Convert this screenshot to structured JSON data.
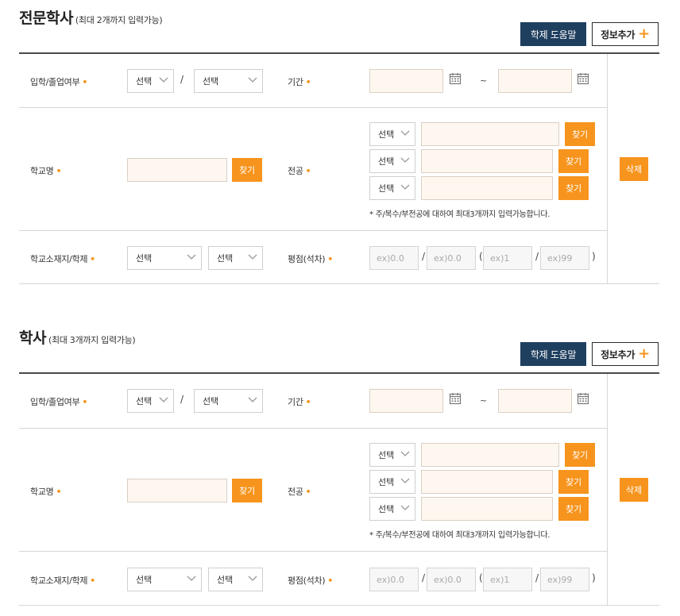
{
  "sections": [
    {
      "title": "전문학사",
      "subtitle": "(최대 2개까지 입력가능)",
      "help_button": "학제 도움말",
      "add_button": "정보추가",
      "rows": {
        "admission_label": "입학/졸업여부",
        "admission_select_1": "선택",
        "admission_select_2": "선택",
        "period_label": "기간",
        "school_label": "학교명",
        "school_find": "찾기",
        "major_label": "전공",
        "major_selects": [
          "선택",
          "선택",
          "선택"
        ],
        "major_find": [
          "찾기",
          "찾기",
          "찾기"
        ],
        "major_note": "* 주/복수/부전공에 대하여 최대3개까지 입력가능합니다.",
        "location_label": "학교소재지/학제",
        "location_select_1": "선택",
        "location_select_2": "선택",
        "gpa_label": "평점(석차)",
        "gpa_placeholder_1": "ex)0.0",
        "gpa_placeholder_2": "ex)0.0",
        "rank_placeholder_1": "ex)1",
        "rank_placeholder_2": "ex)99"
      },
      "delete_button": "삭제"
    },
    {
      "title": "학사",
      "subtitle": "(최대 3개까지 입력가능)",
      "help_button": "학제 도움말",
      "add_button": "정보추가",
      "rows": {
        "admission_label": "입학/졸업여부",
        "admission_select_1": "선택",
        "admission_select_2": "선택",
        "period_label": "기간",
        "school_label": "학교명",
        "school_find": "찾기",
        "major_label": "전공",
        "major_selects": [
          "선택",
          "선택",
          "선택"
        ],
        "major_find": [
          "찾기",
          "찾기",
          "찾기"
        ],
        "major_note": "* 주/복수/부전공에 대하여 최대3개까지 입력가능합니다.",
        "location_label": "학교소재지/학제",
        "location_select_1": "선택",
        "location_select_2": "선택",
        "gpa_label": "평점(석차)",
        "gpa_placeholder_1": "ex)0.0",
        "gpa_placeholder_2": "ex)0.0",
        "rank_placeholder_1": "ex)1",
        "rank_placeholder_2": "ex)99"
      },
      "delete_button": "삭제"
    }
  ],
  "symbols": {
    "slash": "/",
    "tilde": "~",
    "open_paren": "(",
    "close_paren": ")",
    "required_dot": "•"
  },
  "colors": {
    "accent": "#f7941d",
    "navy": "#1f3f5f",
    "input_bg": "#fef7ef"
  },
  "icons": {
    "calendar": "calendar-icon",
    "chevron": "chevron-down-icon",
    "plus": "plus-icon"
  }
}
